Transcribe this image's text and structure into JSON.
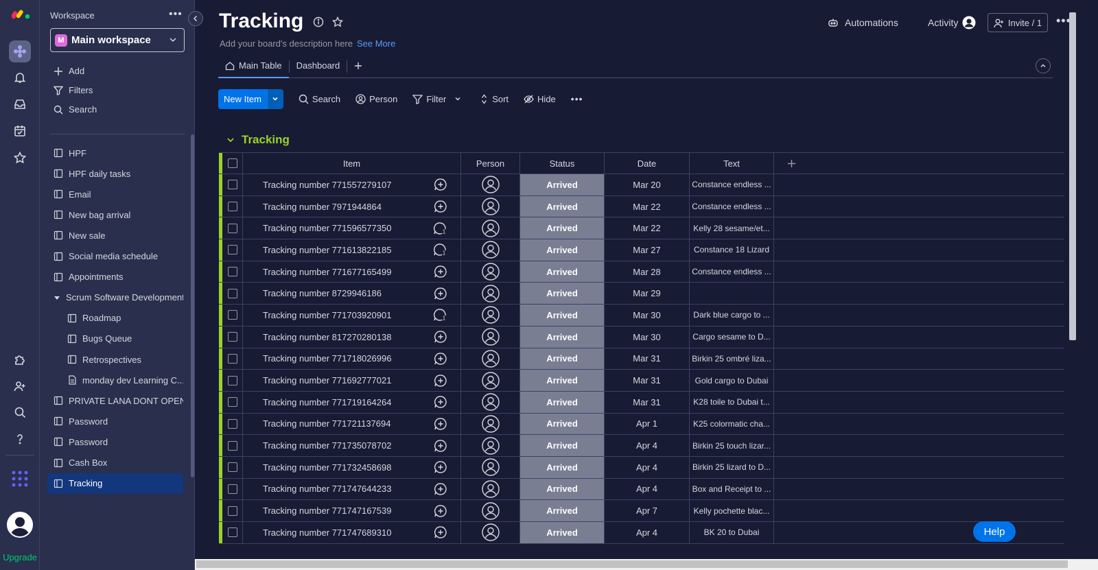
{
  "rail": {
    "upgrade_label": "Upgrade"
  },
  "sidebar": {
    "workspace_label": "Workspace",
    "workspace_name": "Main workspace",
    "workspace_badge": "M",
    "actions": [
      "Add",
      "Filters",
      "Search"
    ],
    "items": [
      {
        "label": "HPF",
        "level": 0
      },
      {
        "label": "HPF daily tasks",
        "level": 0
      },
      {
        "label": "Email",
        "level": 0
      },
      {
        "label": "New bag arrival",
        "level": 0
      },
      {
        "label": "New sale",
        "level": 0
      },
      {
        "label": "Social media schedule",
        "level": 0
      },
      {
        "label": "Appointments",
        "level": 0
      },
      {
        "label": "Scrum Software Development",
        "level": 0,
        "folder": true
      },
      {
        "label": "Roadmap",
        "level": 1
      },
      {
        "label": "Bugs Queue",
        "level": 1
      },
      {
        "label": "Retrospectives",
        "level": 1
      },
      {
        "label": "monday dev Learning C...",
        "level": 1,
        "doc": true
      },
      {
        "label": "PRIVATE LANA DONT OPEN",
        "level": 0
      },
      {
        "label": "Password",
        "level": 0
      },
      {
        "label": "Password",
        "level": 0
      },
      {
        "label": "Cash Box",
        "level": 0
      },
      {
        "label": "Tracking",
        "level": 0,
        "selected": true
      }
    ]
  },
  "header": {
    "title": "Tracking",
    "description": "Add your board's description here",
    "see_more": "See More",
    "automations": "Automations",
    "activity": "Activity",
    "invite": "Invite / 1"
  },
  "tabs": [
    "Main Table",
    "Dashboard"
  ],
  "toolbar": {
    "new_item": "New Item",
    "search": "Search",
    "person": "Person",
    "filter": "Filter",
    "sort": "Sort",
    "hide": "Hide"
  },
  "group": {
    "title": "Tracking",
    "color": "#9cd326"
  },
  "table": {
    "columns": [
      "Item",
      "Person",
      "Status",
      "Date",
      "Text"
    ],
    "rows": [
      {
        "item": "Tracking number 771557279107",
        "status": "Arrived",
        "date": "Mar 20",
        "text": "Constance endless ...",
        "updates": 0
      },
      {
        "item": "Tracking number 7971944864",
        "status": "Arrived",
        "date": "Mar 22",
        "text": "Constance endless ...",
        "updates": 0
      },
      {
        "item": "Tracking number 771596577350",
        "status": "Arrived",
        "date": "Mar 22",
        "text": "Kelly 28 sesame/et...",
        "updates": 1
      },
      {
        "item": "Tracking number 771613822185",
        "status": "Arrived",
        "date": "Mar 27",
        "text": "Constance 18 Lizard",
        "updates": 1
      },
      {
        "item": "Tracking number 771677165499",
        "status": "Arrived",
        "date": "Mar 28",
        "text": "Constance endless ...",
        "updates": 0
      },
      {
        "item": "Tracking number 8729946186",
        "status": "Arrived",
        "date": "Mar 29",
        "text": "",
        "updates": 0
      },
      {
        "item": "Tracking number 771703920901",
        "status": "Arrived",
        "date": "Mar 30",
        "text": "Dark blue cargo to ...",
        "updates": 1
      },
      {
        "item": "Tracking number 817270280138",
        "status": "Arrived",
        "date": "Mar 30",
        "text": "Cargo sesame to D...",
        "updates": 0
      },
      {
        "item": "Tracking number 771718026996",
        "status": "Arrived",
        "date": "Mar 31",
        "text": "Birkin 25 ombré liza...",
        "updates": 0
      },
      {
        "item": "Tracking number 771692777021",
        "status": "Arrived",
        "date": "Mar 31",
        "text": "Gold cargo to Dubai",
        "updates": 0
      },
      {
        "item": "Tracking number 771719164264",
        "status": "Arrived",
        "date": "Mar 31",
        "text": "K28 toile to Dubai t...",
        "updates": 0
      },
      {
        "item": "Tracking number 771721137694",
        "status": "Arrived",
        "date": "Apr 1",
        "text": "K25 colormatic cha...",
        "updates": 0
      },
      {
        "item": "Tracking number 771735078702",
        "status": "Arrived",
        "date": "Apr 4",
        "text": "Birkin 25 touch lizar...",
        "updates": 0
      },
      {
        "item": "Tracking number 771732458698",
        "status": "Arrived",
        "date": "Apr 4",
        "text": "Birkin 25 lizard to D...",
        "updates": 0
      },
      {
        "item": "Tracking number 771747644233",
        "status": "Arrived",
        "date": "Apr 4",
        "text": "Box and Receipt to ...",
        "updates": 0
      },
      {
        "item": "Tracking number 771747167539",
        "status": "Arrived",
        "date": "Apr 7",
        "text": "Kelly pochette blac...",
        "updates": 0
      },
      {
        "item": "Tracking number 771747689310",
        "status": "Arrived",
        "date": "Apr 4",
        "text": "BK 20 to Dubai",
        "updates": 0
      }
    ]
  },
  "help": "Help",
  "colors": {
    "accent": "#0073ea",
    "status_arrived": "#797e93",
    "group": "#9cd326",
    "background": "#181b34"
  }
}
